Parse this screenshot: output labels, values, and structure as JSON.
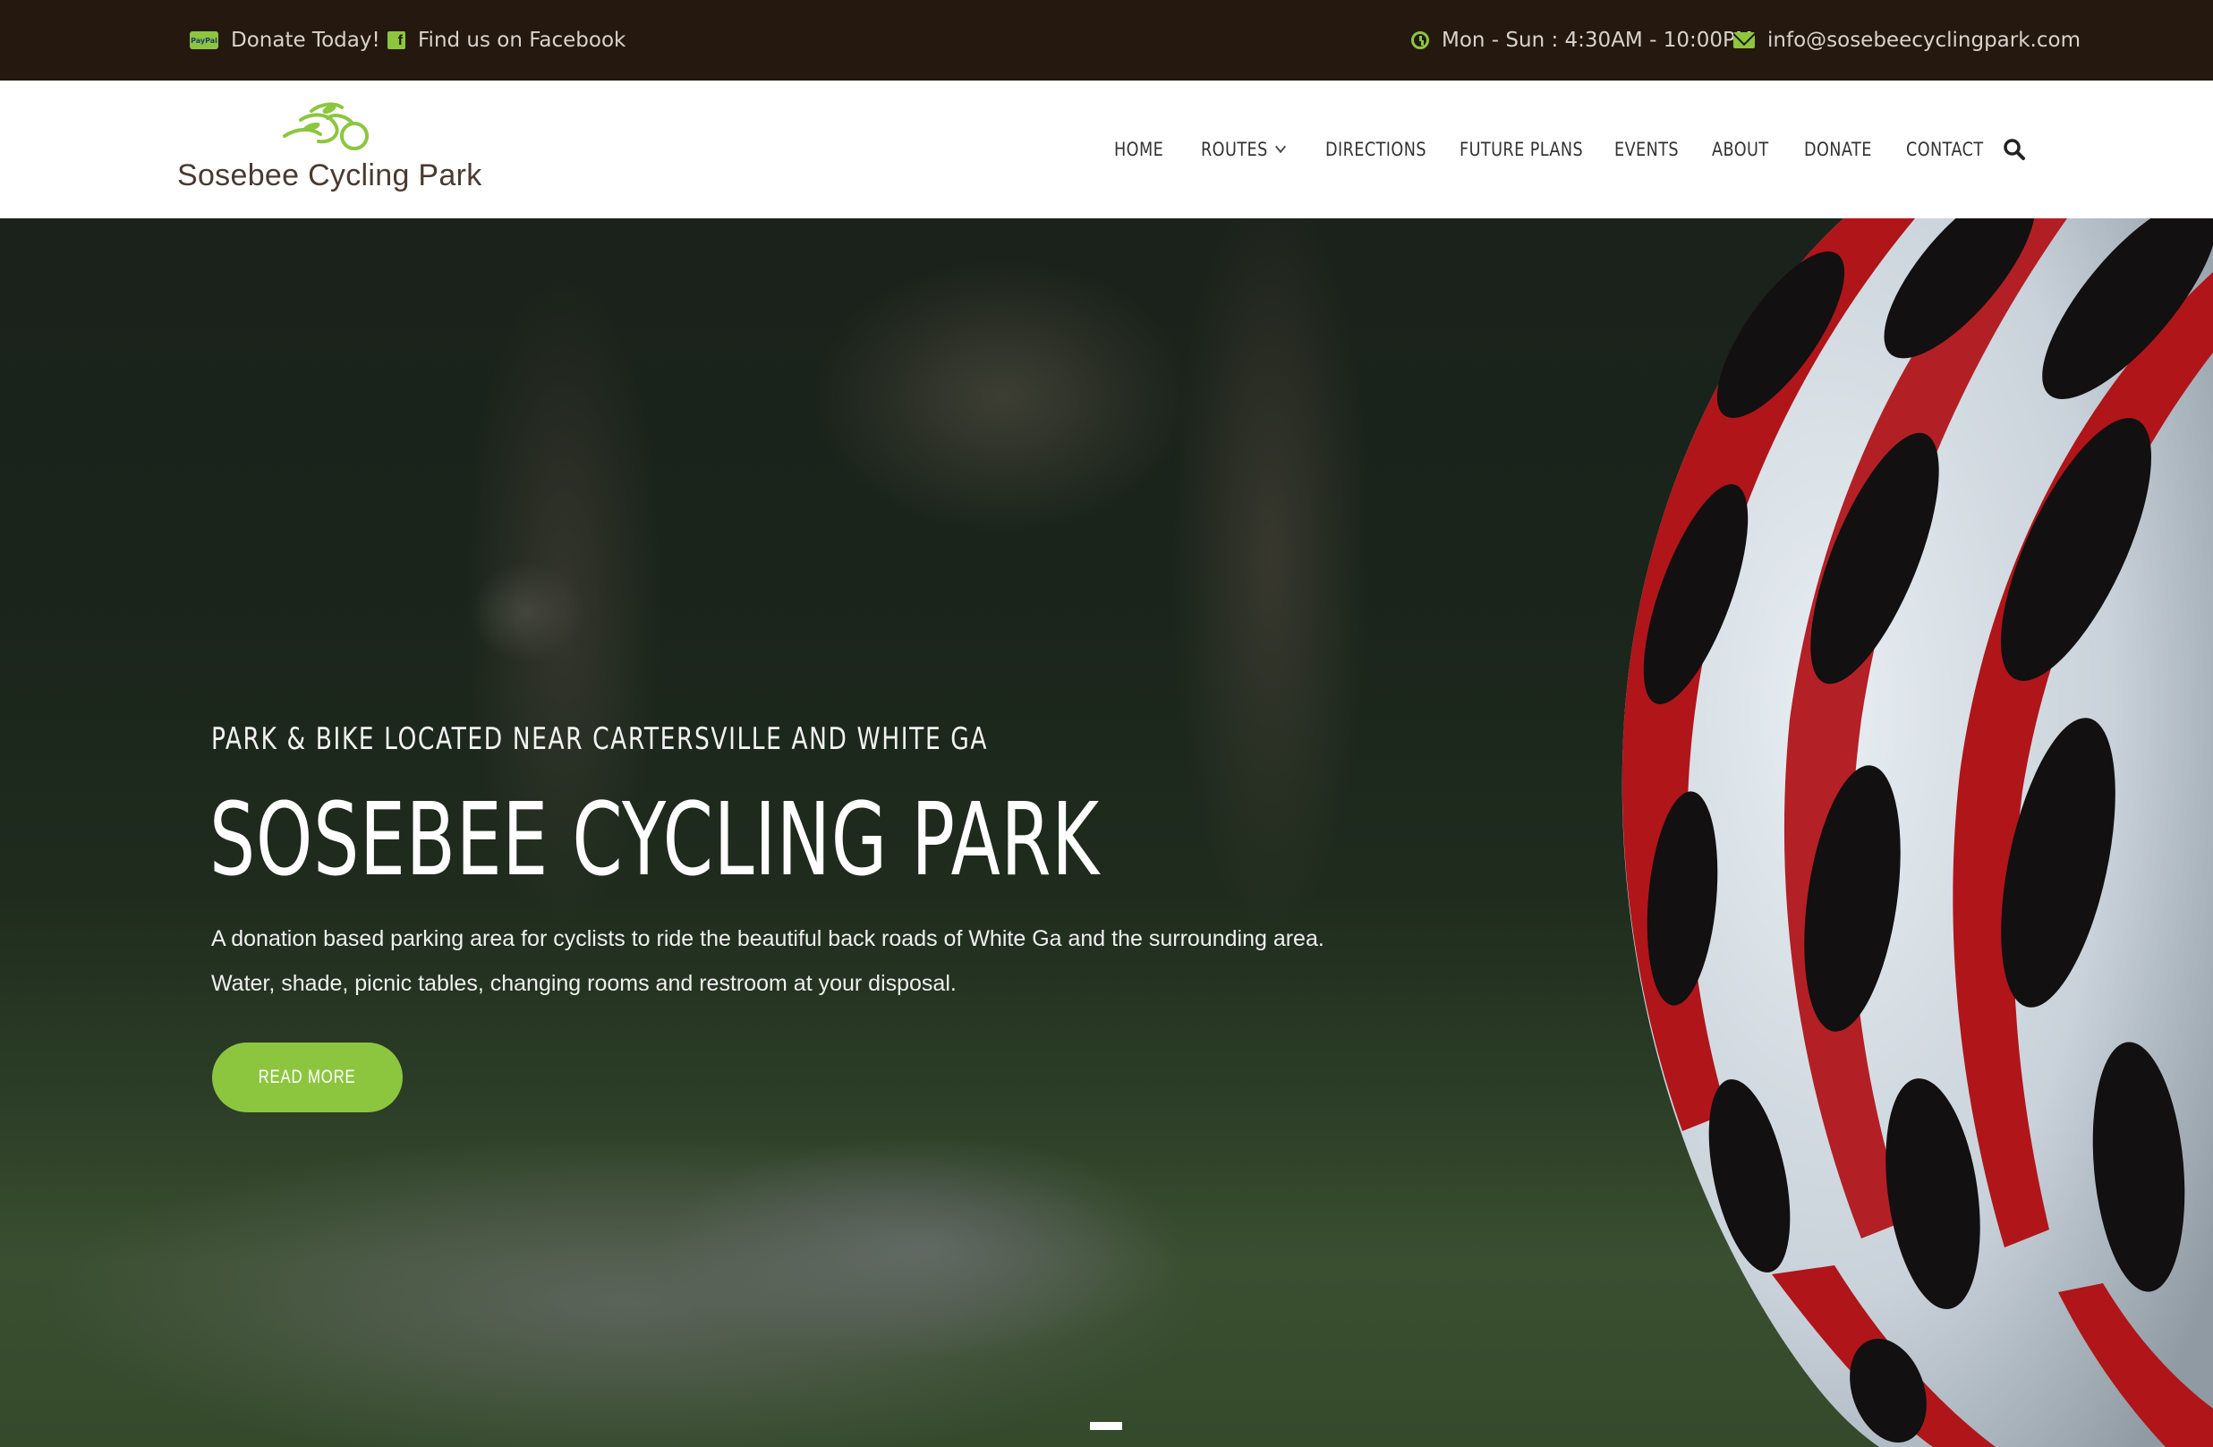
{
  "topbar": {
    "donate_label": "Donate Today!",
    "paypal_badge": "PayPal",
    "facebook_label": "Find us on Facebook",
    "hours": "Mon - Sun : 4:30AM - 10:00PM",
    "email": "info@sosebeecyclingpark.com"
  },
  "header": {
    "logo_text": "Sosebee Cycling Park",
    "nav": [
      {
        "label": "HOME"
      },
      {
        "label": "ROUTES"
      },
      {
        "label": "DIRECTIONS"
      },
      {
        "label": "FUTURE PLANS"
      },
      {
        "label": "EVENTS"
      },
      {
        "label": "ABOUT"
      },
      {
        "label": "DONATE"
      },
      {
        "label": "CONTACT"
      }
    ]
  },
  "hero": {
    "kicker": "PARK & BIKE LOCATED NEAR CARTERSVILLE AND WHITE GA",
    "title": "SOSEBEE CYCLING PARK",
    "description_line1": "A donation based parking area for cyclists to ride the beautiful back roads of White Ga and the surrounding area.",
    "description_line2": "Water, shade, picnic tables, changing rooms and restroom at your disposal.",
    "button_label": "READ MORE"
  },
  "colors": {
    "accent": "#8cc63f",
    "topbar_bg": "#24180f",
    "header_bg": "#ffffff",
    "nav_text": "#333333"
  },
  "icons": [
    "paypal-icon",
    "facebook-icon",
    "clock-icon",
    "mail-icon",
    "bicycle-logo-icon",
    "chevron-down-icon",
    "search-icon"
  ]
}
